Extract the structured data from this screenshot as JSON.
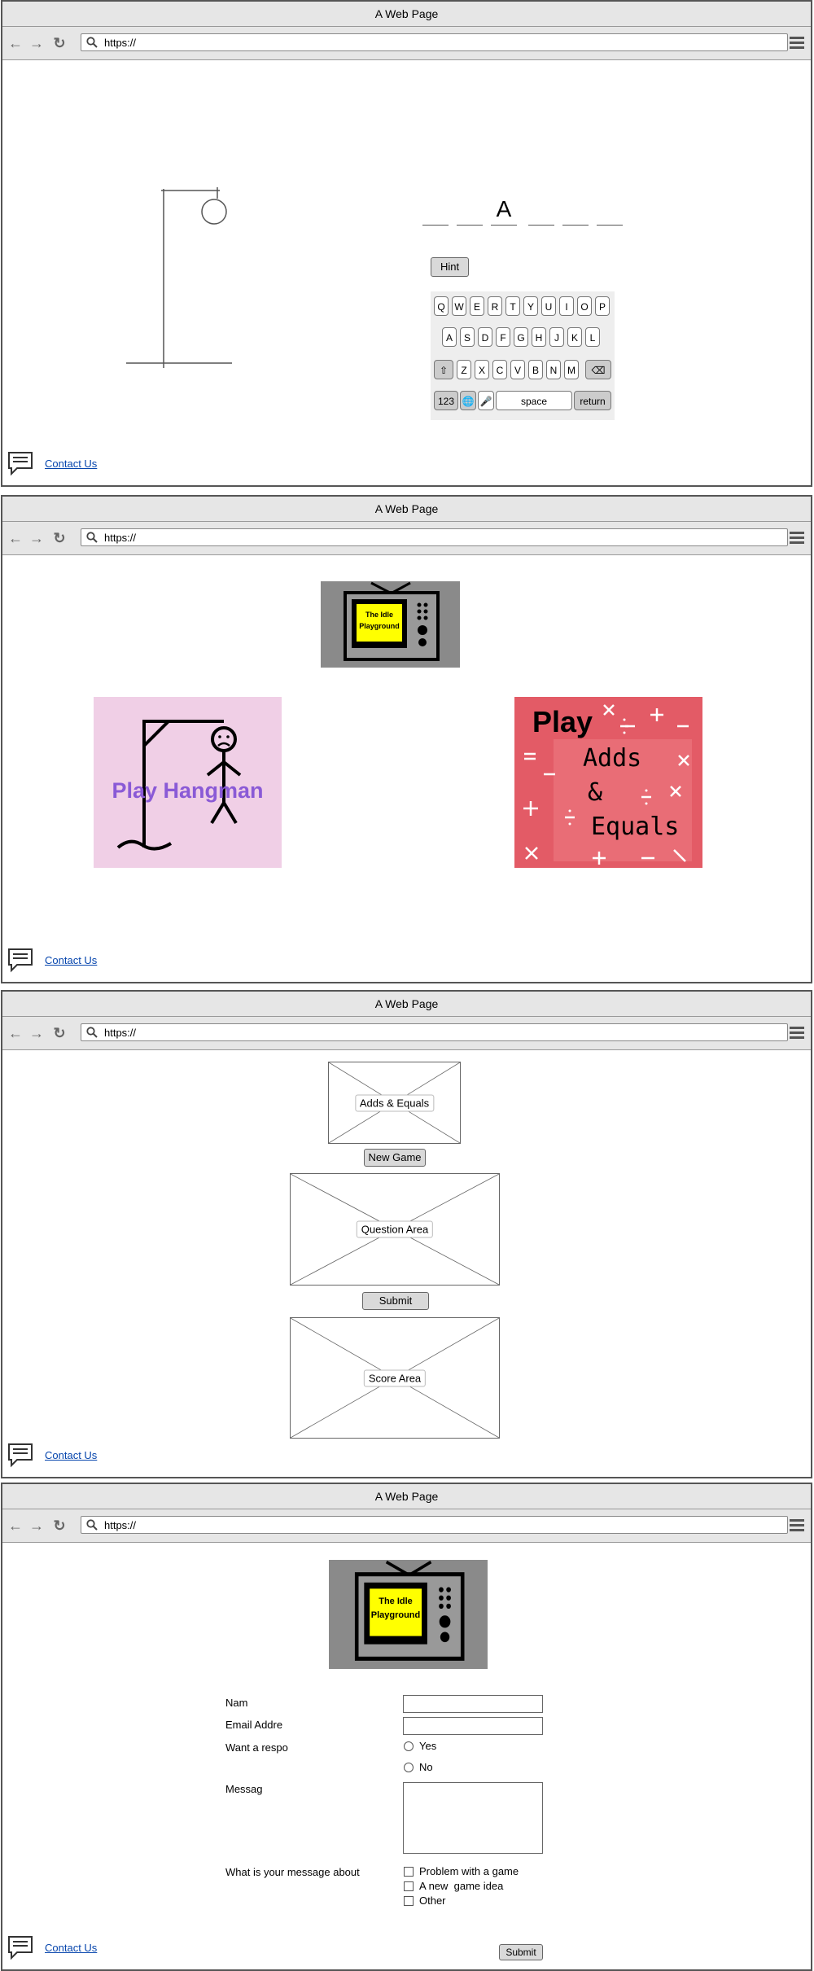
{
  "browser": {
    "title": "A Web Page",
    "url": "https://"
  },
  "footer": {
    "contact_label": "Contact Us"
  },
  "hangman": {
    "word_letters": [
      "",
      "",
      "A",
      "",
      "",
      ""
    ],
    "hint_label": "Hint",
    "keyboard": {
      "row1": [
        "Q",
        "W",
        "E",
        "R",
        "T",
        "Y",
        "U",
        "I",
        "O",
        "P"
      ],
      "row2": [
        "A",
        "S",
        "D",
        "F",
        "G",
        "H",
        "J",
        "K",
        "L"
      ],
      "row3": [
        "Z",
        "X",
        "C",
        "V",
        "B",
        "N",
        "M"
      ],
      "key_123": "123",
      "space_label": "space",
      "return_label": "return"
    }
  },
  "home": {
    "logo_text_1": "The Idle",
    "logo_text_2": "Playground",
    "hangman_tile_label": "Play Hangman",
    "adds_tile_play": "Play",
    "adds_tile_line1": "Adds",
    "adds_tile_line2": "&",
    "adds_tile_line3": "Equals",
    "colors": {
      "hangman_tile": "#f0cfe6",
      "adds_tile": "#e35b66",
      "logo_yellow": "#ffff00"
    }
  },
  "adds_game": {
    "title_label": "Adds & Equals",
    "new_game_label": "New Game",
    "question_label": "Question Area",
    "submit_label": "Submit",
    "score_label": "Score Area"
  },
  "contact_form": {
    "name_label": "Nam",
    "email_label": "Email Addre",
    "response_label": "Want a respo",
    "yes_label": "Yes",
    "no_label": "No",
    "message_label": "Messag",
    "about_label": "What is your message about",
    "options": [
      "Problem with a game",
      "A new  game idea",
      "Other"
    ],
    "submit_label": "Submit"
  }
}
